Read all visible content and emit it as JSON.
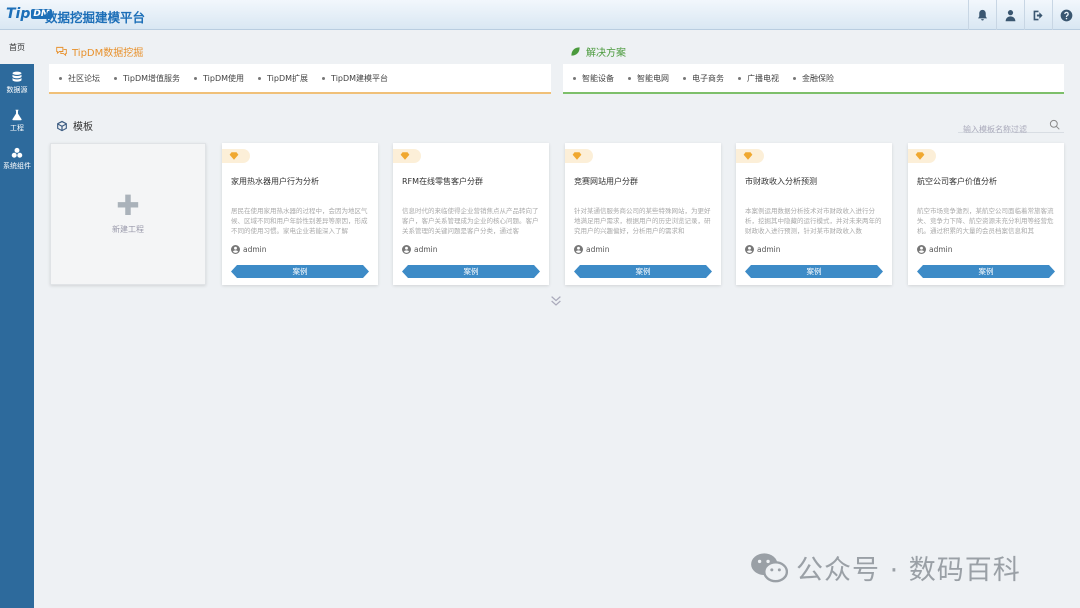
{
  "header": {
    "logo_text": "TipDM",
    "logo_letters": "Tip",
    "logo_badge": "DM",
    "title": "数据挖掘建模平台",
    "icons": [
      "bell-icon",
      "user-icon",
      "logout-icon",
      "help-icon"
    ]
  },
  "sidebar": {
    "home": "首页",
    "items": [
      {
        "label": "数据源",
        "icon": "database-icon"
      },
      {
        "label": "工程",
        "icon": "flask-icon"
      },
      {
        "label": "系统组件",
        "icon": "cubes-icon"
      }
    ]
  },
  "tipdm_section": {
    "title": "TipDM数据挖掘",
    "color": "#e8912c",
    "links": [
      "社区论坛",
      "TipDM增值服务",
      "TipDM使用",
      "TipDM扩展",
      "TipDM建模平台"
    ]
  },
  "solutions_section": {
    "title": "解决方案",
    "color": "#4a9a3c",
    "links": [
      "智能设备",
      "智能电网",
      "电子商务",
      "广播电视",
      "金融保险"
    ]
  },
  "templates": {
    "title": "模板",
    "search_placeholder": "输入模板名称过滤",
    "new_project": "新建工程",
    "cards": [
      {
        "title": "家用热水器用户行为分析",
        "desc": "居民在使用家用热水器的过程中，会因为地区气候、区域不同和用户年龄性别差异等原因，形成不同的使用习惯。家电企业若能深入了解",
        "user": "admin",
        "button": "案例"
      },
      {
        "title": "RFM在线零售客户分群",
        "desc": "信息时代的来临使得企业营销焦点从产品转向了客户，客户关系管理成为企业的核心问题。客户关系管理的关键问题是客户分类，通过客",
        "user": "admin",
        "button": "案例"
      },
      {
        "title": "竞赛网站用户分群",
        "desc": "针对某通信服务商公司的某些特殊网站，为更好地满足用户需求，根据用户的历史浏览记录，研究用户的兴趣偏好，分析用户的需求和",
        "user": "admin",
        "button": "案例"
      },
      {
        "title": "市财政收入分析预测",
        "desc": "本案例运用数据分析技术对市财政收入进行分析，挖掘其中隐藏的运行模式，并对未来两年的财政收入进行预测，针对某市财政收入数",
        "user": "admin",
        "button": "案例"
      },
      {
        "title": "航空公司客户价值分析",
        "desc": "航空市场竞争激烈，某航空公司面临着常旅客流失、竞争力下降、航空资源未充分利用等经营危机。通过积累的大量的会员档案信息和其",
        "user": "admin",
        "button": "案例"
      }
    ]
  },
  "watermark": "公众号 · 数码百科"
}
